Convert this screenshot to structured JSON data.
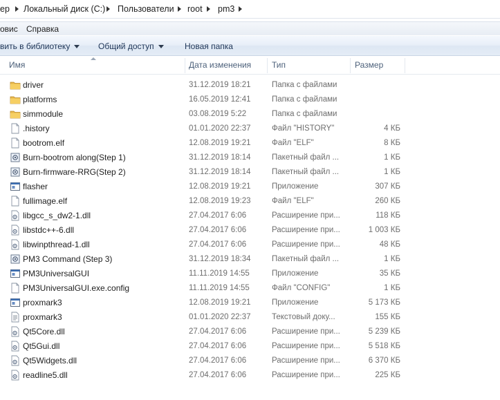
{
  "breadcrumb": [
    "ер",
    "Локальный диск (C:)",
    "Пользователи",
    "root",
    "pm3"
  ],
  "menu": [
    "овис",
    "Справка"
  ],
  "commands": {
    "library": "вить в библиотеку",
    "share": "Общий доступ",
    "new_folder": "Новая папка"
  },
  "columns": {
    "name": "Имя",
    "date": "Дата изменения",
    "type": "Тип",
    "size": "Размер"
  },
  "files": [
    {
      "name": "driver",
      "date": "31.12.2019 18:21",
      "type": "Папка с файлами",
      "size": "",
      "icon": "folder-icon"
    },
    {
      "name": "platforms",
      "date": "16.05.2019 12:41",
      "type": "Папка с файлами",
      "size": "",
      "icon": "folder-icon"
    },
    {
      "name": "simmodule",
      "date": "03.08.2019 5:22",
      "type": "Папка с файлами",
      "size": "",
      "icon": "folder-icon"
    },
    {
      "name": ".history",
      "date": "01.01.2020 22:37",
      "type": "Файл \"HISTORY\"",
      "size": "4 КБ",
      "icon": "file-icon"
    },
    {
      "name": "bootrom.elf",
      "date": "12.08.2019 19:21",
      "type": "Файл \"ELF\"",
      "size": "8 КБ",
      "icon": "file-icon"
    },
    {
      "name": "Burn-bootrom along(Step 1)",
      "date": "31.12.2019 18:14",
      "type": "Пакетный файл ...",
      "size": "1 КБ",
      "icon": "batch-file-icon"
    },
    {
      "name": "Burn-firmware-RRG(Step 2)",
      "date": "31.12.2019 18:14",
      "type": "Пакетный файл ...",
      "size": "1 КБ",
      "icon": "batch-file-icon"
    },
    {
      "name": "flasher",
      "date": "12.08.2019 19:21",
      "type": "Приложение",
      "size": "307 КБ",
      "icon": "application-icon"
    },
    {
      "name": "fullimage.elf",
      "date": "12.08.2019 19:23",
      "type": "Файл \"ELF\"",
      "size": "260 КБ",
      "icon": "file-icon"
    },
    {
      "name": "libgcc_s_dw2-1.dll",
      "date": "27.04.2017 6:06",
      "type": "Расширение при...",
      "size": "118 КБ",
      "icon": "dll-icon"
    },
    {
      "name": "libstdc++-6.dll",
      "date": "27.04.2017 6:06",
      "type": "Расширение при...",
      "size": "1 003 КБ",
      "icon": "dll-icon"
    },
    {
      "name": "libwinpthread-1.dll",
      "date": "27.04.2017 6:06",
      "type": "Расширение при...",
      "size": "48 КБ",
      "icon": "dll-icon"
    },
    {
      "name": "PM3 Command (Step 3)",
      "date": "31.12.2019 18:34",
      "type": "Пакетный файл ...",
      "size": "1 КБ",
      "icon": "batch-file-icon"
    },
    {
      "name": "PM3UniversalGUI",
      "date": "11.11.2019 14:55",
      "type": "Приложение",
      "size": "35 КБ",
      "icon": "application-icon"
    },
    {
      "name": "PM3UniversalGUI.exe.config",
      "date": "11.11.2019 14:55",
      "type": "Файл \"CONFIG\"",
      "size": "1 КБ",
      "icon": "file-icon"
    },
    {
      "name": "proxmark3",
      "date": "12.08.2019 19:21",
      "type": "Приложение",
      "size": "5 173 КБ",
      "icon": "application-icon"
    },
    {
      "name": "proxmark3",
      "date": "01.01.2020 22:37",
      "type": "Текстовый доку...",
      "size": "155 КБ",
      "icon": "text-file-icon"
    },
    {
      "name": "Qt5Core.dll",
      "date": "27.04.2017 6:06",
      "type": "Расширение при...",
      "size": "5 239 КБ",
      "icon": "dll-icon"
    },
    {
      "name": "Qt5Gui.dll",
      "date": "27.04.2017 6:06",
      "type": "Расширение при...",
      "size": "5 518 КБ",
      "icon": "dll-icon"
    },
    {
      "name": "Qt5Widgets.dll",
      "date": "27.04.2017 6:06",
      "type": "Расширение при...",
      "size": "6 370 КБ",
      "icon": "dll-icon"
    },
    {
      "name": "readline5.dll",
      "date": "27.04.2017 6:06",
      "type": "Расширение при...",
      "size": "225 КБ",
      "icon": "dll-icon"
    }
  ]
}
